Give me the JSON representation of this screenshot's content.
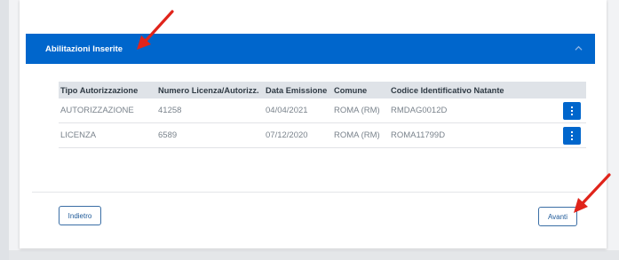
{
  "panel": {
    "title": "Abilitazioni Inserite",
    "header_color": "#0066cc",
    "toggle_icon": "chevron-up-icon"
  },
  "table": {
    "columns": [
      "Tipo Autorizzazione",
      "Numero Licenza/Autorizz.",
      "Data Emissione",
      "Comune",
      "Codice Identificativo Natante"
    ],
    "rows": [
      {
        "tipo": "AUTORIZZAZIONE",
        "numero": "41258",
        "data": "04/04/2021",
        "comune": "ROMA (RM)",
        "codice": "RMDAG0012D",
        "action_icon": "more-vertical-icon"
      },
      {
        "tipo": "LICENZA",
        "numero": "6589",
        "data": "07/12/2020",
        "comune": "ROMA (RM)",
        "codice": "ROMA11799D",
        "action_icon": "more-vertical-icon"
      }
    ]
  },
  "footer": {
    "back_label": "Indietro",
    "next_label": "Avanti"
  },
  "annotations": {
    "arrow_color": "#e0241b"
  }
}
